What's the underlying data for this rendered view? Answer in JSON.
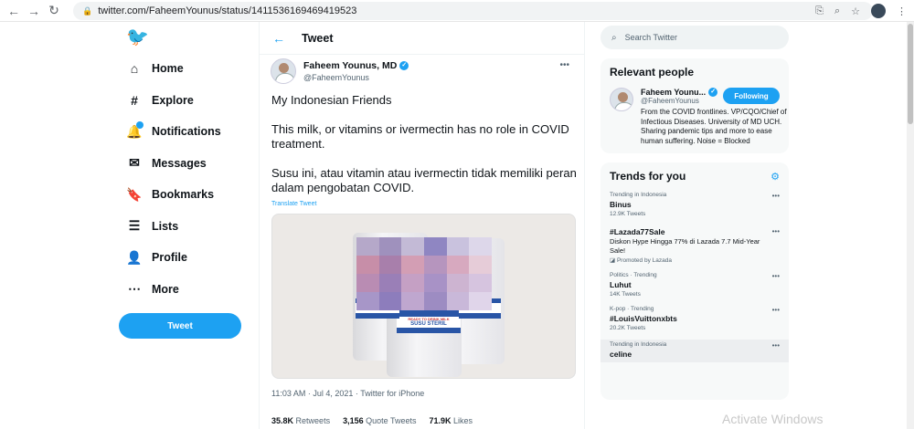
{
  "browser": {
    "url": "twitter.com/FaheemYounus/status/1411536169469419523",
    "back_icon": "←",
    "forward_icon": "→",
    "reload_icon": "↻"
  },
  "sidebar": {
    "items": [
      {
        "label": "Home",
        "icon": "⌂"
      },
      {
        "label": "Explore",
        "icon": "#"
      },
      {
        "label": "Notifications",
        "icon": "🔔"
      },
      {
        "label": "Messages",
        "icon": "✉"
      },
      {
        "label": "Bookmarks",
        "icon": "🔖"
      },
      {
        "label": "Lists",
        "icon": "☰"
      },
      {
        "label": "Profile",
        "icon": "👤"
      },
      {
        "label": "More",
        "icon": "⋯"
      }
    ],
    "tweet_button": "Tweet"
  },
  "main": {
    "header_title": "Tweet",
    "author_name": "Faheem Younus, MD",
    "author_handle": "@FaheemYounus",
    "paragraphs": [
      "My Indonesian Friends",
      "This milk, or vitamins or ivermectin has no role in COVID treatment.",
      "Susu ini, atau vitamin atau ivermectin tidak memiliki peran dalam pengobatan COVID."
    ],
    "translate": "Translate Tweet",
    "timestamp": "11:03 AM · Jul 4, 2021 · Twitter for iPhone",
    "stats": [
      {
        "count": "35.8K",
        "label": "Retweets"
      },
      {
        "count": "3,156",
        "label": "Quote Tweets"
      },
      {
        "count": "71.9K",
        "label": "Likes"
      }
    ],
    "image_text": [
      "SUSU STERIL",
      "READY TO DRINK MILK"
    ]
  },
  "right": {
    "search_placeholder": "Search Twitter",
    "relevant_title": "Relevant people",
    "person": {
      "name": "Faheem Younu...",
      "handle": "@FaheemYounus",
      "follow_label": "Following",
      "bio": "From the COVID frontlines. VP/CQO/Chief of Infectious Diseases. University of MD UCH. Sharing pandemic tips and more to ease human suffering. Noise = Blocked"
    },
    "trends_title": "Trends for you",
    "trends": [
      {
        "context": "Trending in Indonesia",
        "name": "Binus",
        "desc": "",
        "count": "12.9K Tweets"
      },
      {
        "context": "",
        "name": "#Lazada77Sale",
        "desc": "Diskon Hype Hingga 77% di Lazada 7.7 Mid-Year Sale!",
        "count": "Promoted by Lazada"
      },
      {
        "context": "Politics · Trending",
        "name": "Luhut",
        "desc": "",
        "count": "14K Tweets"
      },
      {
        "context": "K-pop · Trending",
        "name": "#LouisVuittonxbts",
        "desc": "",
        "count": "20.2K Tweets"
      },
      {
        "context": "Trending in Indonesia",
        "name": "celine",
        "desc": "",
        "count": ""
      }
    ]
  },
  "watermark": "Activate Windows",
  "colors": {
    "accent": "#1da1f2",
    "text": "#0f1419",
    "muted": "#536471"
  }
}
